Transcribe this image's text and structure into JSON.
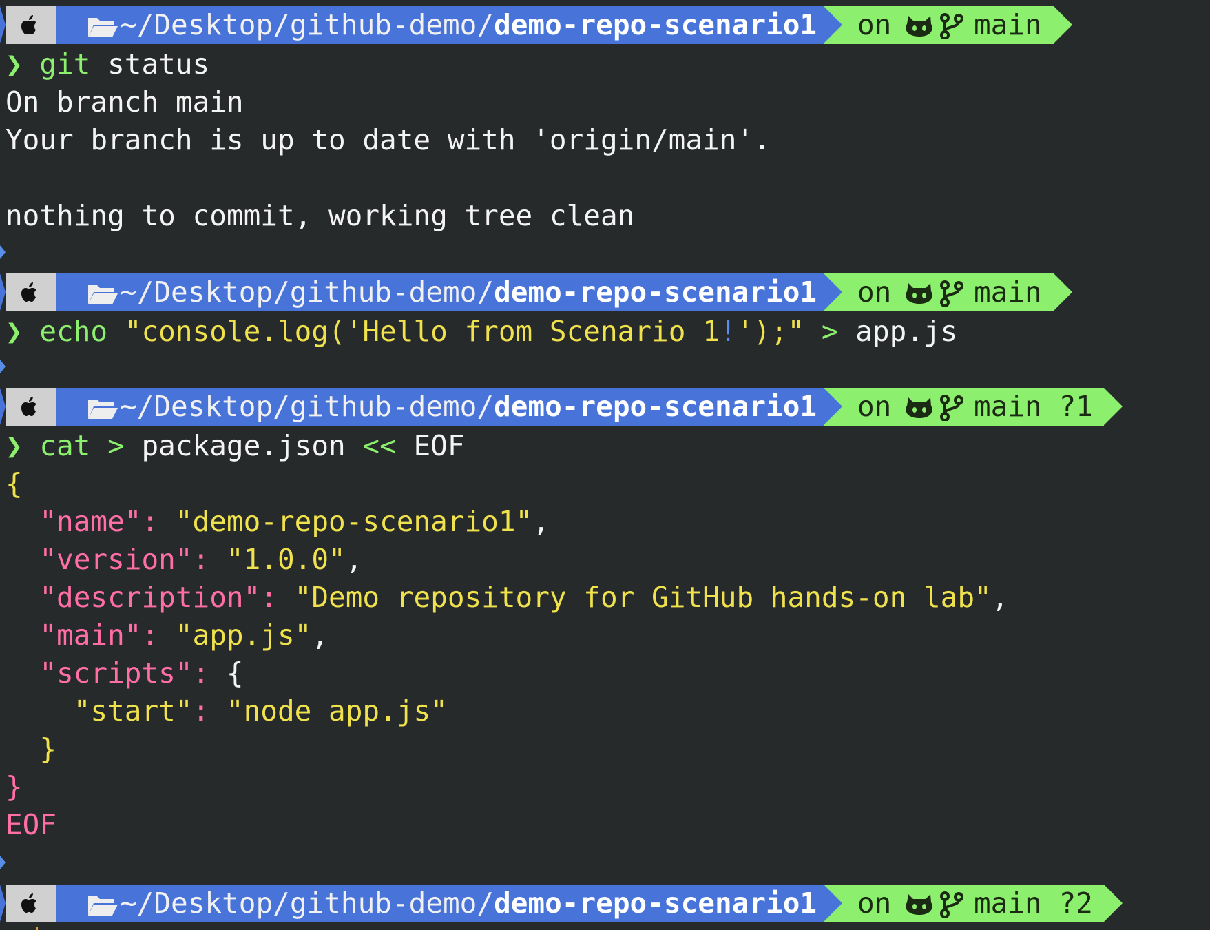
{
  "prompt": {
    "dir_prefix": "~/Desktop/github-demo/",
    "dir_repo": "demo-repo-scenario1",
    "on": "on",
    "branch": "main",
    "status_1": "?1",
    "status_2": "?2"
  },
  "icons": {
    "apple": "apple-icon",
    "folder": "folder-open-icon",
    "github": "github-cat-icon",
    "branch": "git-branch-icon"
  },
  "colors": {
    "segment_dir": "#4873d8",
    "segment_git": "#8cef6e",
    "segment_os": "#d0d0d0",
    "background": "#272a2b"
  },
  "terminal": {
    "chevron": "❯",
    "cmd1": {
      "name": "git",
      "args": " status"
    },
    "out1": [
      "On branch main",
      "Your branch is up to date with 'origin/main'.",
      "",
      "nothing to commit, working tree clean"
    ],
    "cmd2": {
      "name": "echo",
      "str_a": " \"console.log('Hello from Scenario 1",
      "bang": "!",
      "str_b": "');\"",
      "op": " >",
      "file": " app.js"
    },
    "cmd3": {
      "name": "cat",
      "op1": " >",
      "file": " package.json",
      "op2": " <<",
      "eof": " EOF"
    },
    "heredoc": {
      "open_brace": "{",
      "name_key": "\"name\"",
      "name_val": "\"demo-repo-scenario1\"",
      "version_key": "\"version\"",
      "version_val": "\"1.0.0\"",
      "description_key": "\"description\"",
      "description_val": "\"Demo repository for GitHub hands-on lab\"",
      "main_key": "\"main\"",
      "main_val": "\"app.js\"",
      "scripts_key": "\"scripts\"",
      "scripts_open": "{",
      "start_key": "\"start\"",
      "start_val": "\"node app.js\"",
      "scripts_close": "}",
      "close_brace": "}",
      "eof": "EOF"
    }
  }
}
